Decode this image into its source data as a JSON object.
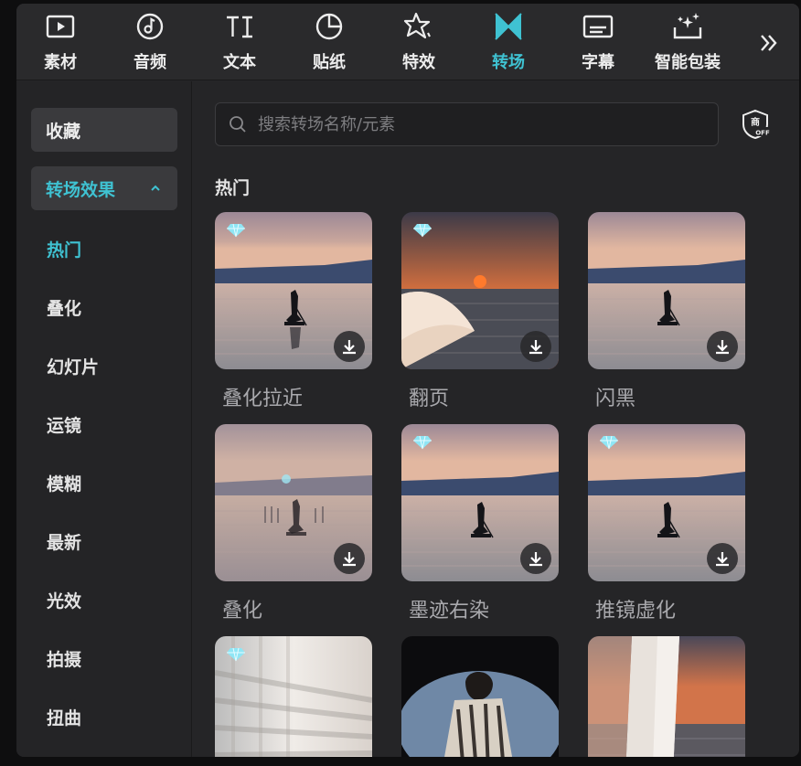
{
  "toolbar": {
    "tabs": [
      {
        "label": "素材",
        "icon": "media-icon"
      },
      {
        "label": "音频",
        "icon": "audio-icon"
      },
      {
        "label": "文本",
        "icon": "text-icon"
      },
      {
        "label": "贴纸",
        "icon": "sticker-icon"
      },
      {
        "label": "特效",
        "icon": "effects-icon"
      },
      {
        "label": "转场",
        "icon": "transition-icon",
        "active": true
      },
      {
        "label": "字幕",
        "icon": "caption-icon"
      },
      {
        "label": "智能包装",
        "icon": "smart-pack-icon"
      }
    ],
    "more_icon": "double-chevron-right-icon"
  },
  "sidebar": {
    "favorites": "收藏",
    "category": "转场效果",
    "items": [
      "热门",
      "叠化",
      "幻灯片",
      "运镜",
      "模糊",
      "最新",
      "光效",
      "拍摄",
      "扭曲"
    ],
    "active_item": "热门"
  },
  "search": {
    "placeholder": "搜索转场名称/元素",
    "value": ""
  },
  "commercial_badge": {
    "icon": "commercial-off-icon",
    "text_top": "商",
    "text_bottom": "OFF"
  },
  "section": {
    "title": "热门"
  },
  "cards": [
    {
      "label": "叠化拉近",
      "premium": true
    },
    {
      "label": "翻页",
      "premium": true
    },
    {
      "label": "闪黑",
      "premium": false
    },
    {
      "label": "叠化",
      "premium": false
    },
    {
      "label": "墨迹右染",
      "premium": true
    },
    {
      "label": "推镜虚化",
      "premium": true
    },
    {
      "label": "",
      "premium": true
    },
    {
      "label": "",
      "premium": false
    },
    {
      "label": "",
      "premium": false
    }
  ],
  "colors": {
    "accent": "#3fc2d2",
    "panel": "#252527",
    "gem": "#7fe0f0"
  }
}
